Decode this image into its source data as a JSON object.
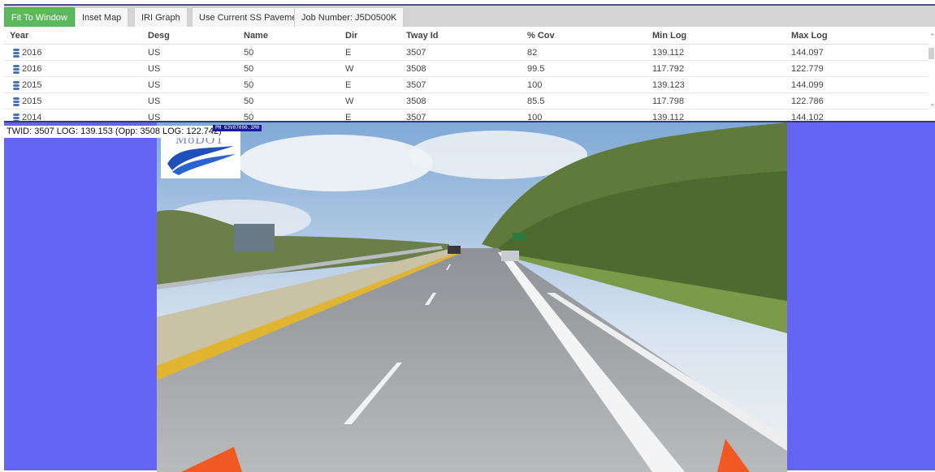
{
  "toolbar": {
    "fit_to_window": "Fit To Window",
    "inset_map": "Inset Map",
    "iri_graph": "IRI Graph",
    "use_current_ss_pavement": "Use Current SS Pavement",
    "job_number": "Job Number: J5D0500K"
  },
  "grid": {
    "headers": [
      "Year",
      "Desg",
      "Name",
      "Dir",
      "Tway Id",
      "% Cov",
      "Min Log",
      "Max Log"
    ],
    "rows": [
      [
        "2016",
        "US",
        "50",
        "E",
        "3507",
        "82",
        "139.112",
        "144.097"
      ],
      [
        "2016",
        "US",
        "50",
        "W",
        "3508",
        "99.5",
        "117.792",
        "122.779"
      ],
      [
        "2015",
        "US",
        "50",
        "E",
        "3507",
        "100",
        "139.123",
        "144.099"
      ],
      [
        "2015",
        "US",
        "50",
        "W",
        "3508",
        "85.5",
        "117.798",
        "122.786"
      ],
      [
        "2014",
        "US",
        "50",
        "E",
        "3507",
        "100",
        "139.112",
        "144.102"
      ]
    ],
    "row_icon": "database-icon"
  },
  "viewer": {
    "twid_label": "TWID: 3507 LOG: 139.153 (Opp: 3508 LOG: 122.742)",
    "pm_tag": "PM   63V07000.1M0",
    "logo_text": "MoDOT"
  },
  "colors": {
    "viewer_background": "#6464f5",
    "active_button": "#5cb85c",
    "toolbar_background": "#d4d4d4"
  }
}
